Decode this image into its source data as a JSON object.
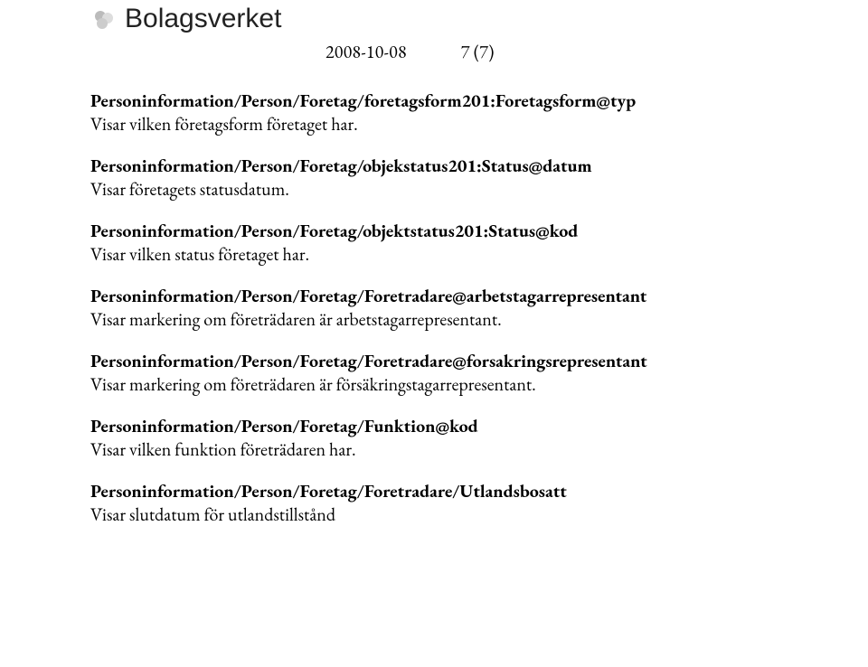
{
  "header": {
    "brand": "Bolagsverket",
    "date": "2008-10-08",
    "page_indicator": "7 (7)"
  },
  "entries": [
    {
      "path": "Personinformation/Person/Foretag/foretagsform201:Foretagsform@typ",
      "desc": "Visar vilken företagsform företaget har."
    },
    {
      "path": "Personinformation/Person/Foretag/objekstatus201:Status@datum",
      "desc": "Visar företagets statusdatum."
    },
    {
      "path": "Personinformation/Person/Foretag/objektstatus201:Status@kod",
      "desc": "Visar vilken status företaget har."
    },
    {
      "path": "Personinformation/Person/Foretag/Foretradare@arbetstagarrepresentant",
      "desc": "Visar markering om företrädaren är arbetstagarrepresentant."
    },
    {
      "path": "Personinformation/Person/Foretag/Foretradare@forsakringsrepresentant",
      "desc": "Visar markering om företrädaren är försäkringstagarrepresentant."
    },
    {
      "path": "Personinformation/Person/Foretag/Funktion@kod",
      "desc": "Visar vilken funktion företrädaren har."
    },
    {
      "path": "Personinformation/Person/Foretag/Foretradare/Utlandsbosatt",
      "desc": "Visar slutdatum för utlandstillstånd"
    }
  ]
}
